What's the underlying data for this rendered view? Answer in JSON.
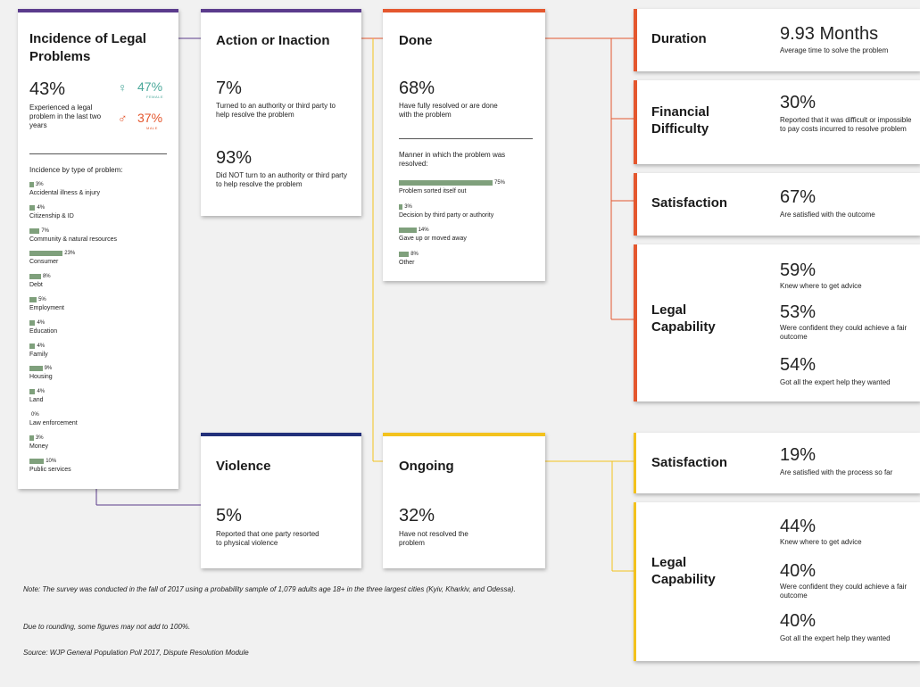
{
  "incidence": {
    "title": "Incidence of Legal Problems",
    "pct": "43%",
    "desc": "Experienced a legal problem in the last two years",
    "female_pct": "47%",
    "female_label": "FEMALE",
    "male_pct": "37%",
    "male_label": "MALE",
    "female_symbol": "♀",
    "male_symbol": "♂",
    "by_type_title": "Incidence by type of problem:",
    "types": [
      {
        "label": "Accidental illness & injury",
        "value": 3,
        "text": "3%"
      },
      {
        "label": "Citizenship & ID",
        "value": 4,
        "text": "4%"
      },
      {
        "label": "Community & natural resources",
        "value": 7,
        "text": "7%"
      },
      {
        "label": "Consumer",
        "value": 23,
        "text": "23%"
      },
      {
        "label": "Debt",
        "value": 8,
        "text": "8%"
      },
      {
        "label": "Employment",
        "value": 5,
        "text": "5%"
      },
      {
        "label": "Education",
        "value": 4,
        "text": "4%"
      },
      {
        "label": "Family",
        "value": 4,
        "text": "4%"
      },
      {
        "label": "Housing",
        "value": 9,
        "text": "9%"
      },
      {
        "label": "Land",
        "value": 4,
        "text": "4%"
      },
      {
        "label": "Law enforcement",
        "value": 0,
        "text": "0%"
      },
      {
        "label": "Money",
        "value": 3,
        "text": "3%"
      },
      {
        "label": "Public services",
        "value": 10,
        "text": "10%"
      }
    ]
  },
  "action": {
    "title": "Action or Inaction",
    "pct1": "7%",
    "desc1": "Turned to an authority or third party to help resolve the problem",
    "pct2": "93%",
    "desc2": "Did NOT turn to an authority or third party to help resolve the problem"
  },
  "done": {
    "title": "Done",
    "pct": "68%",
    "desc": "Have fully resolved or are done with the problem",
    "manner_title": "Manner in which the problem was resolved:",
    "manner": [
      {
        "label": "Problem sorted itself out",
        "value": 75,
        "text": "75%"
      },
      {
        "label": "Decision by third party or authority",
        "value": 3,
        "text": "3%"
      },
      {
        "label": "Gave up or moved away",
        "value": 14,
        "text": "14%"
      },
      {
        "label": "Other",
        "value": 8,
        "text": "8%"
      }
    ]
  },
  "violence": {
    "title": "Violence",
    "pct": "5%",
    "desc": "Reported that one party resorted to physical violence"
  },
  "ongoing": {
    "title": "Ongoing",
    "pct": "32%",
    "desc": "Have not resolved the problem"
  },
  "done_outcomes": {
    "duration": {
      "title": "Duration",
      "value": "9.93 Months",
      "desc": "Average time to solve the problem"
    },
    "financial": {
      "title": "Financial Difficulty",
      "value": "30%",
      "desc": "Reported that it was difficult or impossible to pay costs incurred to resolve problem"
    },
    "satisfaction": {
      "title": "Satisfaction",
      "value": "67%",
      "desc": "Are satisfied with the outcome"
    },
    "capability": {
      "title": "Legal Capability",
      "items": [
        {
          "value": "59%",
          "desc": "Knew where to get advice"
        },
        {
          "value": "53%",
          "desc": "Were confident they could achieve a fair outcome"
        },
        {
          "value": "54%",
          "desc": "Got all the expert help they wanted"
        }
      ]
    }
  },
  "ongoing_outcomes": {
    "satisfaction": {
      "title": "Satisfaction",
      "value": "19%",
      "desc": "Are satisfied with the process so far"
    },
    "capability": {
      "title": "Legal Capability",
      "items": [
        {
          "value": "44%",
          "desc": "Knew where to get advice"
        },
        {
          "value": "40%",
          "desc": "Were confident they could achieve a fair outcome"
        },
        {
          "value": "40%",
          "desc": "Got all the expert help they wanted"
        }
      ]
    }
  },
  "notes": {
    "note": "Note: The survey was conducted in the fall of 2017 using a probability sample of 1,079 adults age 18+ in the three largest cities (Kyiv, Kharkiv, and Odessa).",
    "rounding": "Due to rounding, some figures may not add to 100%.",
    "source": "Source: WJP General Population Poll 2017, Dispute Resolution Module"
  },
  "colors": {
    "purple": "#5b3b8c",
    "orange": "#e4572e",
    "navy": "#22307a",
    "yellow": "#f3c21d",
    "bar_green": "#7fa07c",
    "female_teal": "#4aa89a",
    "male_red": "#e4572e"
  }
}
